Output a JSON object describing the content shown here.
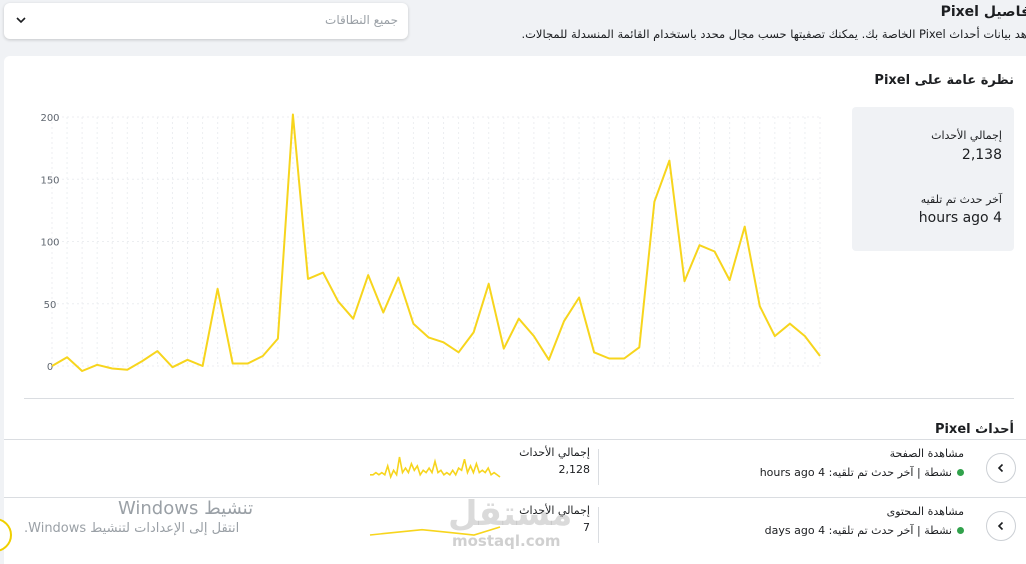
{
  "header": {
    "title": "فاصيل Pixel",
    "description": "اهد بيانات أحداث Pixel الخاصة بك. يمكنك تصفيتها حسب مجال محدد باستخدام القائمة المنسدلة للمجالات.",
    "filter_placeholder": "جميع النطاقات"
  },
  "overview": {
    "title": "نظرة عامة على Pixel",
    "total_label": "إجمالي الأحداث",
    "total_value": "2,138",
    "last_label": "آخر حدث تم تلقيه",
    "last_value": "4 hours ago"
  },
  "chart_data": {
    "type": "line",
    "color": "#f7d51d",
    "y_ticks": [
      "200",
      "150",
      "100",
      "50",
      "0"
    ],
    "ylim": [
      0,
      200
    ],
    "grid": true,
    "series": [
      {
        "values": [
          0,
          7,
          -4,
          1,
          -2,
          -3,
          4,
          12,
          -1,
          5,
          0,
          62,
          2,
          2,
          8,
          22,
          202,
          70,
          75,
          52,
          38,
          73,
          43,
          71,
          34,
          23,
          19,
          11,
          27,
          66,
          14,
          38,
          24,
          5,
          36,
          55,
          11,
          6,
          6,
          15,
          132,
          165,
          68,
          97,
          92,
          69,
          112,
          48,
          24,
          34,
          24,
          8
        ]
      }
    ]
  },
  "events": {
    "title": "أحداث Pixel",
    "rows": [
      {
        "name": "مشاهدة الصفحة",
        "status": "نشطة | آخر حدث تم تلقيه: 4 hours ago",
        "total_label": "إجمالي الأحداث",
        "total_value": "2,128",
        "sparkline": [
          4,
          4,
          5,
          4,
          5,
          4,
          8,
          3,
          6,
          4,
          12,
          5,
          7,
          5,
          9,
          6,
          8,
          4,
          6,
          5,
          7,
          5,
          10,
          5,
          6,
          4,
          5,
          4,
          6,
          4,
          7,
          6,
          11,
          5,
          8,
          5,
          9,
          5,
          6,
          5,
          7,
          4,
          5,
          4,
          3
        ]
      },
      {
        "name": "مشاهدة المحتوى",
        "status": "نشطة | آخر حدث تم تلقيه: 4 days ago",
        "total_label": "إجمالي الأحداث",
        "total_value": "7",
        "sparkline": [
          1,
          2,
          3,
          2,
          1,
          4
        ]
      }
    ]
  },
  "watermark": {
    "title": "تنشيط Windows",
    "subtitle": "انتقل إلى الإعدادات لتنشيط Windows.",
    "logo": "مستقل",
    "site": "mostaql.com"
  }
}
